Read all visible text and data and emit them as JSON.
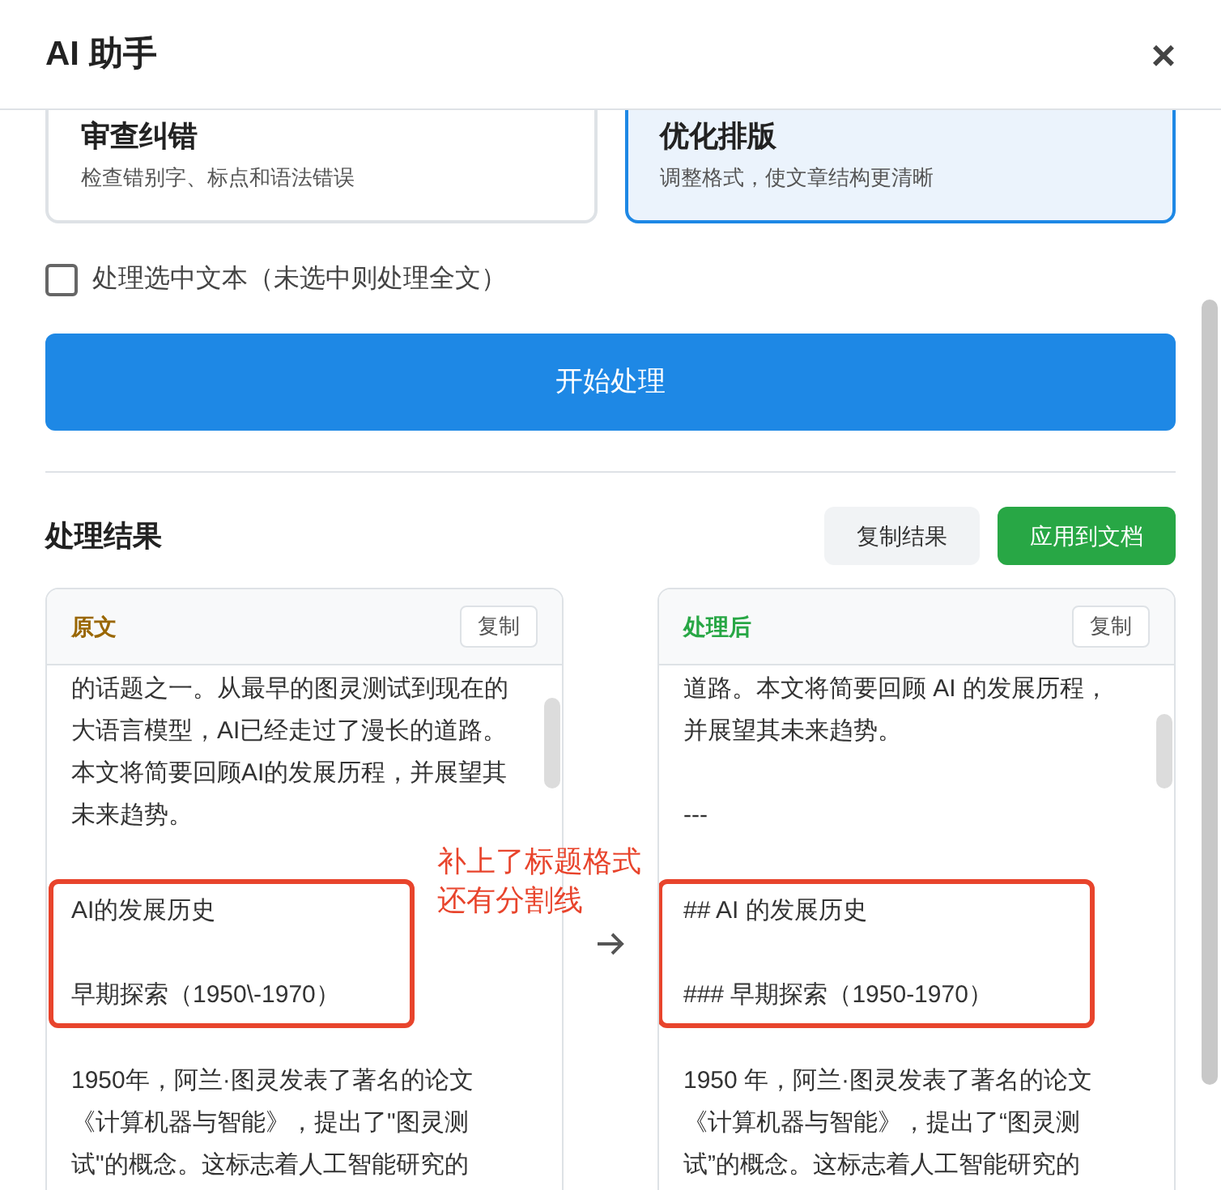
{
  "dialog": {
    "title": "AI 助手",
    "close": "×"
  },
  "modes": [
    {
      "title": "审查纠错",
      "description": "检查错别字、标点和语法错误",
      "selected": false
    },
    {
      "title": "优化排版",
      "description": "调整格式，使文章结构更清晰",
      "selected": true
    }
  ],
  "selection_option": {
    "label": "处理选中文本（未选中则处理全文）",
    "checked": false
  },
  "start_button": "开始处理",
  "results": {
    "title": "处理结果",
    "copy_button": "复制结果",
    "apply_button": "应用到文档",
    "panels": [
      {
        "title": "原文",
        "kind": "original",
        "copy": "复制",
        "blocks": [
          {
            "kind": "paragraph",
            "text": "的话题之一。从最早的图灵测试到现在的大语言模型，AI已经走过了漫长的道路。本文将简要回顾AI的发展历程，并展望其未来趋势。"
          },
          {
            "kind": "highlight",
            "paragraphs": [
              "AI的发展历史",
              "早期探索（1950\\-1970）"
            ]
          },
          {
            "kind": "paragraph",
            "text": "1950年，阿兰·图灵发表了著名的论文《计算机器与智能》，提出了\"图灵测试\"的概念。这标志着人工智能研究的"
          }
        ]
      },
      {
        "title": "处理后",
        "kind": "processed",
        "copy": "复制",
        "blocks": [
          {
            "kind": "paragraph",
            "text": "道路。本文将简要回顾 AI 的发展历程，并展望其未来趋势。"
          },
          {
            "kind": "paragraph",
            "text": "---"
          },
          {
            "kind": "highlight",
            "paragraphs": [
              "## AI 的发展历史",
              "### 早期探索（1950-1970）"
            ]
          },
          {
            "kind": "paragraph",
            "text": "1950 年，阿兰·图灵发表了著名的论文《计算机器与智能》，提出了“图灵测试”的概念。这标志着人工智能研究的"
          }
        ]
      }
    ]
  },
  "annotation": [
    "补上了标题格式",
    "还有分割线"
  ]
}
